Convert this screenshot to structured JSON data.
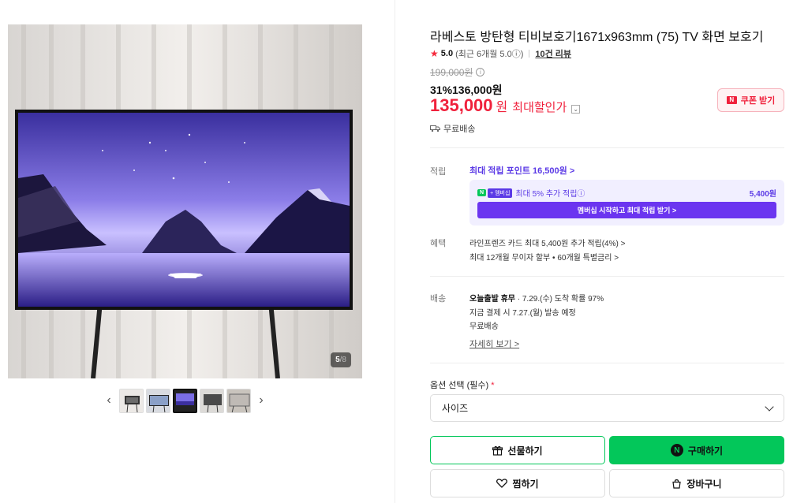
{
  "product": {
    "title": "라베스토 방탄형 티비보호기1671x963mm (75) TV 화면 보호기",
    "rating": "5.0",
    "rating_sub": "(최근 6개월 5.0ⓘ)",
    "reviews": "10건 리뷰",
    "original_price": "199,000원",
    "sale_price": "31%136,000원",
    "max_price": "135,000",
    "max_won": "원",
    "max_label": "최대할인가",
    "coupon_label": "쿠폰 받기",
    "shipping_free": "무료배송"
  },
  "gallery": {
    "counter_current": "5",
    "counter_total": "/8",
    "prev": "‹",
    "next": "›",
    "active_index": 2
  },
  "points": {
    "label": "적립",
    "link": "최대 적립 포인트 16,500원 >",
    "n_badge": "N",
    "plus_badge": "+ 멤버십",
    "extra_text": "최대 5% 추가 적립ⓘ",
    "extra_amount": "5,400원",
    "button": "멤버십 시작하고 최대 적립 받기 >"
  },
  "benefits": {
    "label": "혜택",
    "line1": "라인프렌즈 카드 최대 5,400원 추가 적립(4%) >",
    "line2": "최대 12개월 무이자 할부 • 60개월 특별금리 >"
  },
  "delivery": {
    "label": "배송",
    "line1_bold": "오늘출발 휴무",
    "line1_rest": " · 7.29.(수) 도착 확률 97%",
    "line2": "지금 결제 시 7.27.(월) 발송 예정",
    "line3": "무료배송",
    "detail": "자세히 보기 >"
  },
  "options": {
    "label": "옵션 선택 (필수)",
    "required_mark": "*",
    "select_value": "사이즈"
  },
  "actions": {
    "gift": "선물하기",
    "buy": "구매하기",
    "wish": "찜하기",
    "cart": "장바구니"
  },
  "colors": {
    "accent_red": "#f0213c",
    "naver_green": "#03c75a",
    "membership_purple": "#6b35f0"
  }
}
